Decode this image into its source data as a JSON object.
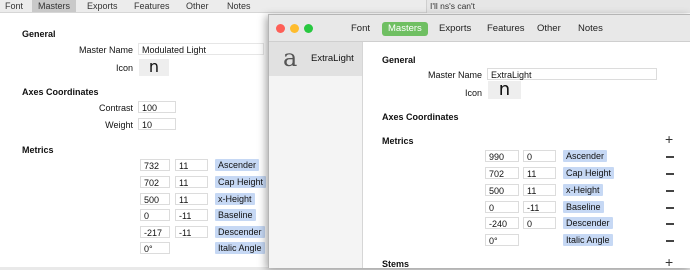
{
  "background_window": {
    "tabs": [
      "Font",
      "Masters",
      "Exports",
      "Features",
      "Other",
      "Notes"
    ],
    "active_tab": "Masters",
    "general": {
      "title": "General",
      "master_name_label": "Master Name",
      "master_name_value": "Modulated Light",
      "icon_label": "Icon",
      "icon_glyph": "n"
    },
    "axes": {
      "title": "Axes Coordinates",
      "rows": [
        {
          "label": "Contrast",
          "value": "100"
        },
        {
          "label": "Weight",
          "value": "10"
        }
      ]
    },
    "metrics": {
      "title": "Metrics",
      "rows": [
        {
          "value": "732",
          "overshoot": "11",
          "name": "Ascender"
        },
        {
          "value": "702",
          "overshoot": "11",
          "name": "Cap Height"
        },
        {
          "value": "500",
          "overshoot": "11",
          "name": "x-Height"
        },
        {
          "value": "0",
          "overshoot": "-11",
          "name": "Baseline"
        },
        {
          "value": "-217",
          "overshoot": "-11",
          "name": "Descender"
        },
        {
          "value": "0°",
          "overshoot": "",
          "name": "Italic Angle"
        }
      ]
    }
  },
  "search_strip": {
    "text": "I'll ns's can't"
  },
  "front_window": {
    "tabs": [
      "Font",
      "Masters",
      "Exports",
      "Features",
      "Other",
      "Notes"
    ],
    "active_tab": "Masters",
    "traffic_light_colors": {
      "close": "#fe5f57",
      "minimize": "#febc2e",
      "zoom": "#28c840"
    },
    "accent_color": "#6fbf62",
    "sidebar": {
      "master_glyph": "a",
      "master_name": "ExtraLight"
    },
    "general": {
      "title": "General",
      "master_name_label": "Master Name",
      "master_name_value": "ExtraLight",
      "icon_label": "Icon",
      "icon_glyph": "n"
    },
    "axes": {
      "title": "Axes Coordinates"
    },
    "metrics": {
      "title": "Metrics",
      "add_symbol": "+",
      "rows": [
        {
          "value": "990",
          "overshoot": "0",
          "name": "Ascender"
        },
        {
          "value": "702",
          "overshoot": "11",
          "name": "Cap Height"
        },
        {
          "value": "500",
          "overshoot": "11",
          "name": "x-Height"
        },
        {
          "value": "0",
          "overshoot": "-11",
          "name": "Baseline"
        },
        {
          "value": "-240",
          "overshoot": "0",
          "name": "Descender"
        },
        {
          "value": "0°",
          "overshoot": "",
          "name": "Italic Angle"
        }
      ]
    },
    "stems": {
      "title": "Stems",
      "add_symbol": "+"
    }
  }
}
